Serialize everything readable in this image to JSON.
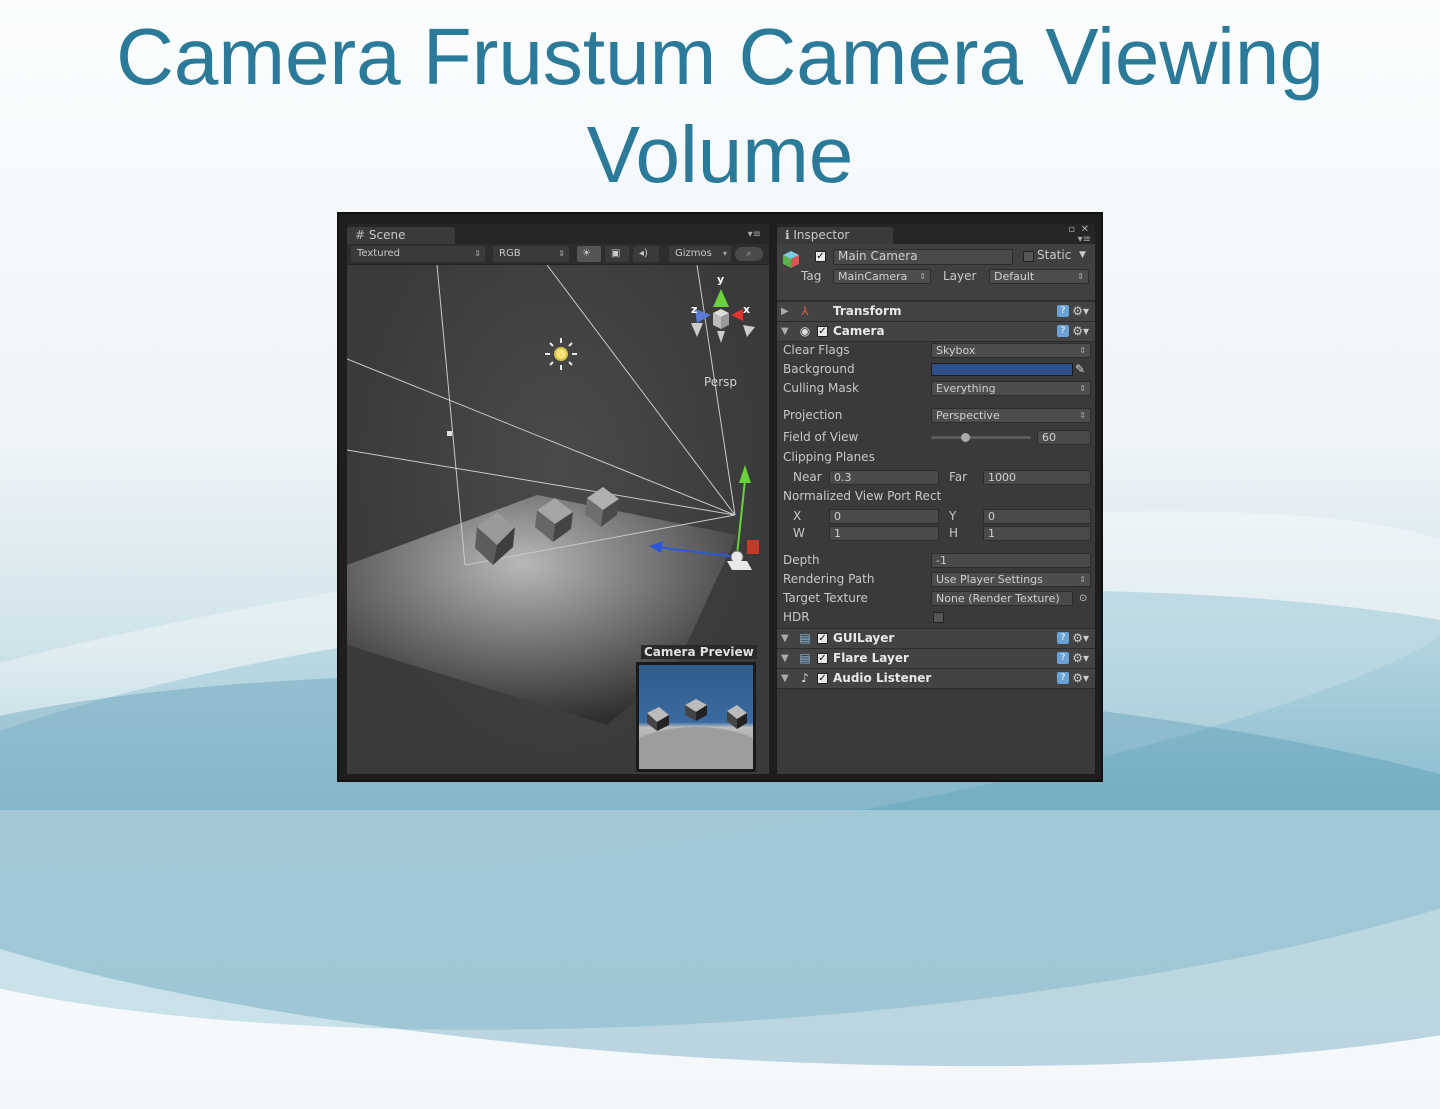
{
  "slide": {
    "title": "Camera Frustum Camera Viewing Volume"
  },
  "scene": {
    "tab_label": "Scene",
    "toolbar": {
      "render_mode": "Textured",
      "channel": "RGB",
      "gizmos": "Gizmos"
    },
    "view_label": "Persp",
    "gizmo_axes": {
      "y": "y",
      "x": "x",
      "z": "z"
    },
    "camera_preview_label": "Camera Preview"
  },
  "inspector": {
    "tab_label": "Inspector",
    "object_name": "Main Camera",
    "static_label": "Static",
    "tag_label": "Tag",
    "tag_value": "MainCamera",
    "layer_label": "Layer",
    "layer_value": "Default",
    "components": {
      "transform": "Transform",
      "camera": "Camera",
      "gui_layer": "GUILayer",
      "flare_layer": "Flare Layer",
      "audio_listener": "Audio Listener"
    },
    "camera": {
      "clear_flags_label": "Clear Flags",
      "clear_flags_value": "Skybox",
      "background_label": "Background",
      "background_color": "#2f4f86",
      "culling_mask_label": "Culling Mask",
      "culling_mask_value": "Everything",
      "projection_label": "Projection",
      "projection_value": "Perspective",
      "fov_label": "Field of View",
      "fov_value": "60",
      "clipping_label": "Clipping Planes",
      "near_label": "Near",
      "near_value": "0.3",
      "far_label": "Far",
      "far_value": "1000",
      "viewport_label": "Normalized View Port Rect",
      "x_label": "X",
      "x_value": "0",
      "y_label": "Y",
      "y_value": "0",
      "w_label": "W",
      "w_value": "1",
      "h_label": "H",
      "h_value": "1",
      "depth_label": "Depth",
      "depth_value": "-1",
      "rendering_path_label": "Rendering Path",
      "rendering_path_value": "Use Player Settings",
      "target_texture_label": "Target Texture",
      "target_texture_value": "None (Render Texture)",
      "hdr_label": "HDR"
    }
  }
}
